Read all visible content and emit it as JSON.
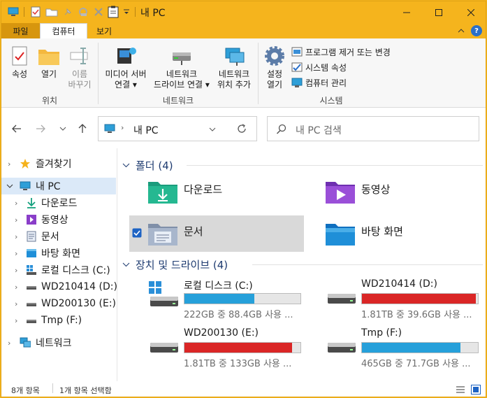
{
  "window": {
    "title": "내 PC",
    "controls": {
      "minimize": "minimize-icon",
      "maximize": "maximize-icon",
      "close": "close-icon"
    }
  },
  "menu_tabs": {
    "file": "파일",
    "computer": "컴퓨터",
    "view": "보기"
  },
  "ribbon": {
    "groups": {
      "location": {
        "label": "위치",
        "properties": "속성",
        "open": "열기",
        "rename_1": "이름",
        "rename_2": "바꾸기"
      },
      "network": {
        "label": "네트워크",
        "media_1": "미디어 서버",
        "media_2": "연결 ▾",
        "map_1": "네트워크",
        "map_2": "드라이브 연결 ▾",
        "add_1": "네트워크",
        "add_2": "위치 추가"
      },
      "system": {
        "label": "시스템",
        "settings_1": "설정",
        "settings_2": "열기",
        "uninstall": "프로그램 제거 또는 변경",
        "sysprops": "시스템 속성",
        "manage": "컴퓨터 관리"
      }
    }
  },
  "navigation": {
    "address": "내 PC",
    "search_placeholder": "내 PC 검색"
  },
  "sidebar": {
    "items": [
      {
        "label": "즐겨찾기"
      },
      {
        "label": "내 PC"
      },
      {
        "label": "다운로드"
      },
      {
        "label": "동영상"
      },
      {
        "label": "문서"
      },
      {
        "label": "바탕 화면"
      },
      {
        "label": "로컬 디스크 (C:)"
      },
      {
        "label": "WD210414 (D:)"
      },
      {
        "label": "WD200130 (E:)"
      },
      {
        "label": "Tmp (F:)"
      },
      {
        "label": "네트워크"
      }
    ]
  },
  "content": {
    "folders_header": "폴더 (4)",
    "folders": [
      {
        "name": "다운로드"
      },
      {
        "name": "동영상"
      },
      {
        "name": "문서"
      },
      {
        "name": "바탕 화면"
      }
    ],
    "drives_header": "장치 및 드라이브 (4)",
    "drives": [
      {
        "name": "로컬 디스크 (C:)",
        "info": "222GB 중 88.4GB 사용 ...",
        "used_fraction": 0.6,
        "color": "#26a0da"
      },
      {
        "name": "WD210414 (D:)",
        "info": "1.81TB 중 39.6GB 사용 ...",
        "used_fraction": 0.98,
        "color": "#da2626"
      },
      {
        "name": "WD200130 (E:)",
        "info": "1.81TB 중 133GB 사용 ...",
        "used_fraction": 0.93,
        "color": "#da2626"
      },
      {
        "name": "Tmp (F:)",
        "info": "465GB 중 71.7GB 사용 ...",
        "used_fraction": 0.85,
        "color": "#26a0da"
      }
    ]
  },
  "status_bar": {
    "count": "8개 항목",
    "selected": "1개 항목 선택함"
  }
}
